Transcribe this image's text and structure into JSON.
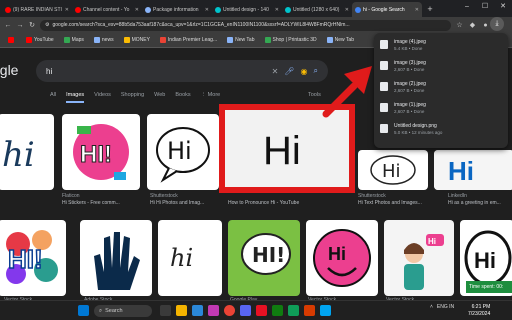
{
  "tabs": [
    {
      "label": "(9) RARE INDIAN STI",
      "color": "#ff0000"
    },
    {
      "label": "Channel content - Yo",
      "color": "#ff0000"
    },
    {
      "label": "Package information",
      "color": "#8ab4f8"
    },
    {
      "label": "Untitled design - 140",
      "color": "#00c4cc"
    },
    {
      "label": "Untitled (1280 x 640)",
      "color": "#00c4cc"
    },
    {
      "label": "hi - Google Search",
      "color": "#4285f4"
    }
  ],
  "address": {
    "url": "google.com/search?sca_esv=88b5da753aaf187c&sca_upv=1&rlz=1C1GCEA_enIN1100IN1100&sxsrf=ADLYWIL8l4W8FmRQrHNlm..."
  },
  "bookmarks": [
    {
      "label": "",
      "color": "#ff0000"
    },
    {
      "label": "YouTube",
      "color": "#ff0000"
    },
    {
      "label": "Maps",
      "color": "#34a853"
    },
    {
      "label": "news",
      "color": "#8ab4f8"
    },
    {
      "label": "MONEY",
      "color": "#fbbc04"
    },
    {
      "label": "Indian Premier Leag...",
      "color": "#ea4335"
    },
    {
      "label": "New Tab",
      "color": "#8ab4f8"
    },
    {
      "label": "Shop | Printastic 3D",
      "color": "#34a853"
    },
    {
      "label": "New Tab",
      "color": "#8ab4f8"
    }
  ],
  "search": {
    "logo": "ogle",
    "query": "hi",
    "tabs": [
      "All",
      "Images",
      "Videos",
      "Shopping",
      "Web",
      "Books",
      "⋮ More"
    ],
    "tools": "Tools"
  },
  "results": {
    "row1": [
      {
        "source": "",
        "title": ""
      },
      {
        "source": "Flaticon",
        "title": "Hi Stickers - Free comm..."
      },
      {
        "source": "Shutterstock",
        "title": "Hi Hi Photos and Imag..."
      },
      {
        "source": "",
        "title": "How to Pronounce Hi - YouTube"
      },
      {
        "source": "Shutterstock",
        "title": "Hi Text Photos and Images..."
      },
      {
        "source": "LinkedIn",
        "title": "Hi as a greeting in em..."
      }
    ],
    "row2": [
      {
        "source": "Vector Stock",
        "title": ""
      },
      {
        "source": "Adobe Stock",
        "title": ""
      },
      {
        "source": "Google Play",
        "title": ""
      },
      {
        "source": "Vector Stock",
        "title": ""
      },
      {
        "source": "Shutterstock",
        "title": ""
      },
      {
        "source": "Vector Stock",
        "title": ""
      },
      {
        "source": "Shutterstock",
        "title": ""
      }
    ],
    "featured_text": "Hi",
    "image_texts": {
      "hi": "hi",
      "HI!": "HI!",
      "Hi": "Hi"
    }
  },
  "downloads": [
    {
      "name": "image (4).jpeg",
      "status": "5.4 KB • Done"
    },
    {
      "name": "image (3).jpeg",
      "status": "2,607 B • Done"
    },
    {
      "name": "image (2).jpeg",
      "status": "2,607 B • Done"
    },
    {
      "name": "image (1).jpeg",
      "status": "2,607 B • Done"
    },
    {
      "name": "Untitled design.png",
      "status": "5.0 KB • 12 minutes ago"
    }
  ],
  "timer": "Time spent: 00:",
  "taskbar": {
    "search": "Search",
    "lang": "ENG IN",
    "time": "6:21 PM",
    "date": "7/23/2024"
  }
}
